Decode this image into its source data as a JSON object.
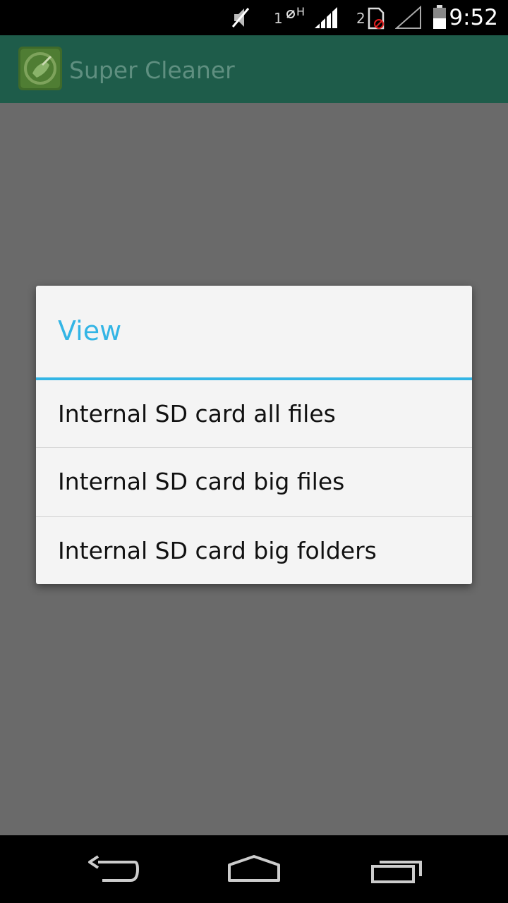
{
  "status_bar": {
    "time": "9:52",
    "sim1_label": "1",
    "sim2_label": "2",
    "icons": [
      "mute-icon",
      "no-sim-data-h-icon",
      "signal-full-icon",
      "sim-blocked-icon",
      "signal-empty-icon",
      "battery-icon"
    ]
  },
  "action_bar": {
    "title": "Super Cleaner",
    "icon": "broom-cleaner-icon",
    "color": "#1e5c4a"
  },
  "dialog": {
    "title": "View",
    "accent_color": "#33b5e5",
    "items": [
      {
        "label": "Internal SD card all files"
      },
      {
        "label": "Internal SD card big files"
      },
      {
        "label": "Internal SD card big folders"
      }
    ]
  },
  "nav_bar": {
    "buttons": [
      "back-icon",
      "home-icon",
      "recents-icon"
    ]
  }
}
